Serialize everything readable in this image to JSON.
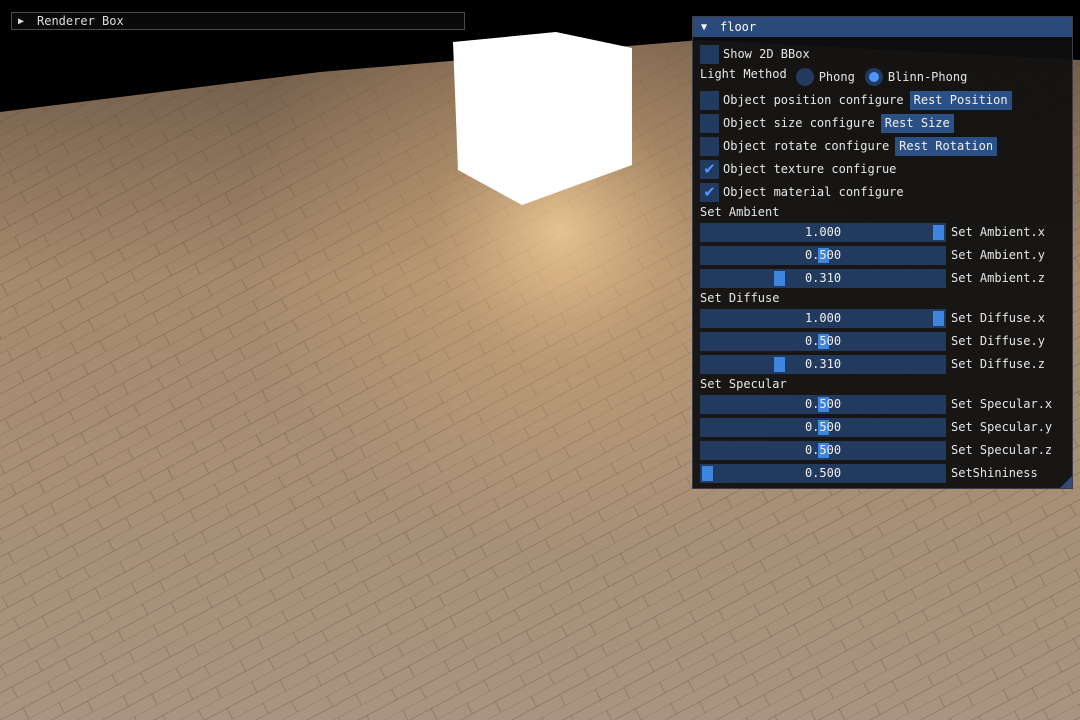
{
  "scene": {
    "background_color": "#000000",
    "floor_color": "#a68b6e",
    "light_cube_color": "#ffffff"
  },
  "renderer_box": {
    "title": "Renderer Box",
    "icon": "triangle-right-icon"
  },
  "panel": {
    "title": "floor",
    "icon": "triangle-down-icon",
    "show_bbox": {
      "label": "Show 2D BBox",
      "checked": false
    },
    "light_method": {
      "label": "Light Method",
      "options": [
        {
          "label": "Phong",
          "selected": false
        },
        {
          "label": "Blinn-Phong",
          "selected": true
        }
      ]
    },
    "position_config": {
      "label": "Object position configure",
      "checked": false,
      "button": "Rest Position"
    },
    "size_config": {
      "label": "Object size configure",
      "checked": false,
      "button": "Rest Size"
    },
    "rotate_config": {
      "label": "Object rotate configure",
      "checked": false,
      "button": "Rest Rotation"
    },
    "texture_config": {
      "label": "Object texture configrue",
      "checked": true
    },
    "material_config": {
      "label": "Object material configure",
      "checked": true
    },
    "ambient": {
      "header": "Set Ambient",
      "sliders": [
        {
          "label": "Set Ambient.x",
          "value": "1.000",
          "level": 1.0
        },
        {
          "label": "Set Ambient.y",
          "value": "0.500",
          "level": 0.5
        },
        {
          "label": "Set Ambient.z",
          "value": "0.310",
          "level": 0.31
        }
      ]
    },
    "diffuse": {
      "header": "Set Diffuse",
      "sliders": [
        {
          "label": "Set Diffuse.x",
          "value": "1.000",
          "level": 1.0
        },
        {
          "label": "Set Diffuse.y",
          "value": "0.500",
          "level": 0.5
        },
        {
          "label": "Set Diffuse.z",
          "value": "0.310",
          "level": 0.31
        }
      ]
    },
    "specular": {
      "header": "Set Specular",
      "sliders": [
        {
          "label": "Set Specular.x",
          "value": "0.500",
          "level": 0.5
        },
        {
          "label": "Set Specular.y",
          "value": "0.500",
          "level": 0.5
        },
        {
          "label": "Set Specular.z",
          "value": "0.500",
          "level": 0.5
        }
      ]
    },
    "shininess": {
      "label": "SetShininess",
      "value": "0.500",
      "level": 0.0
    }
  }
}
